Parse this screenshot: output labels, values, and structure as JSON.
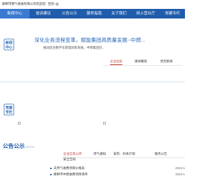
{
  "topbar": {
    "org_name": "邯郸市燃气发展有限公司欢迎您",
    "separator": "|",
    "home_link": "回创"
  },
  "nav": {
    "items": [
      {
        "label": "新闻中心"
      },
      {
        "label": "投诉建议"
      },
      {
        "label": "公告公示"
      },
      {
        "label": "服务指南"
      },
      {
        "label": "关于我们"
      },
      {
        "label": "网上营业厅"
      },
      {
        "label": "党建专栏"
      }
    ]
  },
  "announcement": {
    "icon_text_1": "新闻",
    "icon_text_2": "中心",
    "title": "深化业务流程变革，赋能集团高质量发展--中燃...",
    "subtitle": "推动后台数字化管理创新发展，中燃集团召..."
  },
  "news_tabs": [
    {
      "label": "企业动态",
      "active": true
    },
    {
      "label": "媒体聚焦",
      "active": false
    },
    {
      "label": "党内新闻",
      "active": false
    }
  ],
  "party_section": {
    "icon_text_1": "党建",
    "icon_text_2": "专栏"
  },
  "notice": {
    "title": "公告公示",
    "subtitle": "NOTICE",
    "tabs": [
      {
        "label": "企业信息公开",
        "active": true
      },
      {
        "label": "停气通知",
        "active": false
      },
      {
        "label": "安检、抄表计划",
        "active": false
      },
      {
        "label": "服务公告",
        "active": false
      }
    ],
    "sub_tab": "安全告知",
    "items": [
      {
        "title": "天然气收费项目价格表",
        "date": "2023-1"
      },
      {
        "title": "邯郸市中燃收费项目清单",
        "date": "2023-1"
      }
    ]
  },
  "colors": {
    "nav_bg": "#1f5cab",
    "accent": "#c0392b",
    "title_blue": "#2a68b8"
  }
}
